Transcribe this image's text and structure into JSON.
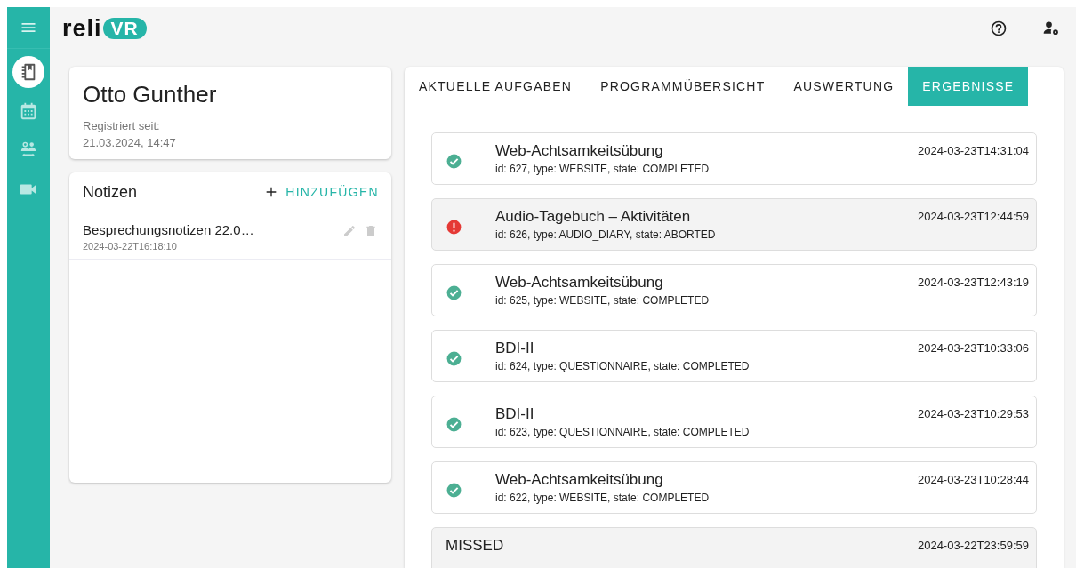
{
  "sidebar": {
    "items": [
      {
        "kind": "notebook",
        "selected": true
      },
      {
        "kind": "calendar",
        "selected": false
      },
      {
        "kind": "people",
        "selected": false
      },
      {
        "kind": "video",
        "selected": false
      }
    ]
  },
  "header": {
    "logo": {
      "text": "reli",
      "badge": "VR"
    }
  },
  "patient": {
    "name": "Otto Gunther",
    "registered_label": "Registriert seit:",
    "registered_date": "21.03.2024, 14:47"
  },
  "notes": {
    "title": "Notizen",
    "add_button": "HINZUFÜGEN",
    "items": [
      {
        "title": "Besprechungsnotizen 22.0…",
        "timestamp": "2024-03-22T16:18:10"
      }
    ]
  },
  "tabs": [
    {
      "label": "AKTUELLE AUFGABEN",
      "selected": false
    },
    {
      "label": "PROGRAMMÜBERSICHT",
      "selected": false
    },
    {
      "label": "AUSWERTUNG",
      "selected": false
    },
    {
      "label": "ERGEBNISSE",
      "selected": true
    }
  ],
  "results": [
    {
      "kind": "completed",
      "title": "Web-Achtsamkeitsübung",
      "details": "id: 627, type: WEBSITE, state: COMPLETED",
      "timestamp": "2024-03-23T14:31:04"
    },
    {
      "kind": "aborted",
      "title": "Audio-Tagebuch – Aktivitäten",
      "details": "id: 626, type: AUDIO_DIARY, state: ABORTED",
      "timestamp": "2024-03-23T12:44:59"
    },
    {
      "kind": "completed",
      "title": "Web-Achtsamkeitsübung",
      "details": "id: 625, type: WEBSITE, state: COMPLETED",
      "timestamp": "2024-03-23T12:43:19"
    },
    {
      "kind": "completed",
      "title": "BDI-II",
      "details": "id: 624, type: QUESTIONNAIRE, state: COMPLETED",
      "timestamp": "2024-03-23T10:33:06"
    },
    {
      "kind": "completed",
      "title": "BDI-II",
      "details": "id: 623, type: QUESTIONNAIRE, state: COMPLETED",
      "timestamp": "2024-03-23T10:29:53"
    },
    {
      "kind": "completed",
      "title": "Web-Achtsamkeitsübung",
      "details": "id: 622, type: WEBSITE, state: COMPLETED",
      "timestamp": "2024-03-23T10:28:44"
    },
    {
      "kind": "missed",
      "title": "MISSED",
      "timestamp": "2024-03-22T23:59:59"
    }
  ]
}
